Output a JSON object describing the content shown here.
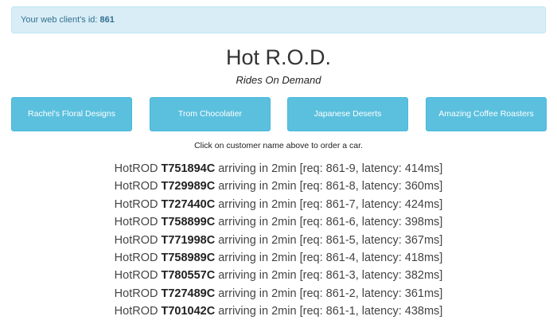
{
  "client": {
    "label": "Your web client's id:",
    "id": "861"
  },
  "header": {
    "title": "Hot R.O.D.",
    "subtitle": "Rides On Demand"
  },
  "customers": [
    {
      "label": "Rachel's Floral Designs"
    },
    {
      "label": "Trom Chocolatier"
    },
    {
      "label": "Japanese Deserts"
    },
    {
      "label": "Amazing Coffee Roasters"
    }
  ],
  "hint": "Click on customer name above to order a car.",
  "rides": [
    {
      "prefix": "HotROD",
      "car": "T751894C",
      "status": "arriving in 2min",
      "details": "[req: 861-9, latency: 414ms]"
    },
    {
      "prefix": "HotROD",
      "car": "T729989C",
      "status": "arriving in 2min",
      "details": "[req: 861-8, latency: 360ms]"
    },
    {
      "prefix": "HotROD",
      "car": "T727440C",
      "status": "arriving in 2min",
      "details": "[req: 861-7, latency: 424ms]"
    },
    {
      "prefix": "HotROD",
      "car": "T758899C",
      "status": "arriving in 2min",
      "details": "[req: 861-6, latency: 398ms]"
    },
    {
      "prefix": "HotROD",
      "car": "T771998C",
      "status": "arriving in 2min",
      "details": "[req: 861-5, latency: 367ms]"
    },
    {
      "prefix": "HotROD",
      "car": "T758989C",
      "status": "arriving in 2min",
      "details": "[req: 861-4, latency: 418ms]"
    },
    {
      "prefix": "HotROD",
      "car": "T780557C",
      "status": "arriving in 2min",
      "details": "[req: 861-3, latency: 382ms]"
    },
    {
      "prefix": "HotROD",
      "car": "T727489C",
      "status": "arriving in 2min",
      "details": "[req: 861-2, latency: 361ms]"
    },
    {
      "prefix": "HotROD",
      "car": "T701042C",
      "status": "arriving in 2min",
      "details": "[req: 861-1, latency: 438ms]"
    }
  ],
  "colors": {
    "alert_bg": "#d9edf7",
    "alert_text": "#31708f",
    "button_bg": "#5bc0de"
  }
}
